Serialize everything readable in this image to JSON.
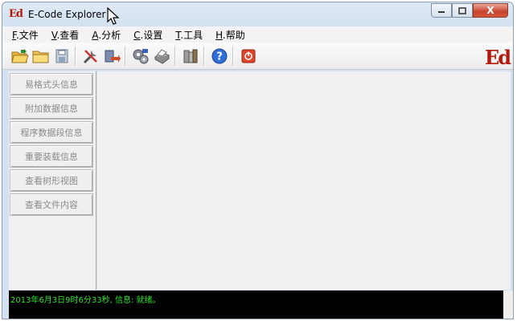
{
  "window": {
    "title": "E-Code Explorer",
    "app_icon_text": "Ed",
    "brand_text": "Ed",
    "close_glyph": "X",
    "colors": {
      "brand": "#b21c0f",
      "status_text": "#2ee22e",
      "status_bg": "#000000"
    }
  },
  "menubar": {
    "items": [
      {
        "mnemonic": "F",
        "label": ".文件"
      },
      {
        "mnemonic": "V",
        "label": ".查看"
      },
      {
        "mnemonic": "A",
        "label": ".分析"
      },
      {
        "mnemonic": "C",
        "label": ".设置"
      },
      {
        "mnemonic": "T",
        "label": ".工具"
      },
      {
        "mnemonic": "H",
        "label": ".帮助"
      }
    ]
  },
  "toolbar": {
    "buttons": [
      "open-folder-icon",
      "folder-icon",
      "save-icon",
      "tools-icon",
      "export-icon",
      "gears-icon",
      "print-icon",
      "library-icon",
      "help-icon",
      "exit-icon"
    ]
  },
  "sidebar": {
    "items": [
      {
        "label": "易格式头信息"
      },
      {
        "label": "附加数据信息"
      },
      {
        "label": "程序数据段信息"
      },
      {
        "label": "重要装载信息"
      },
      {
        "label": "查看树形视图"
      },
      {
        "label": "查看文件内容"
      }
    ]
  },
  "status": {
    "text": "2013年6月3日9时6分33秒, 信息: 就绪。"
  }
}
